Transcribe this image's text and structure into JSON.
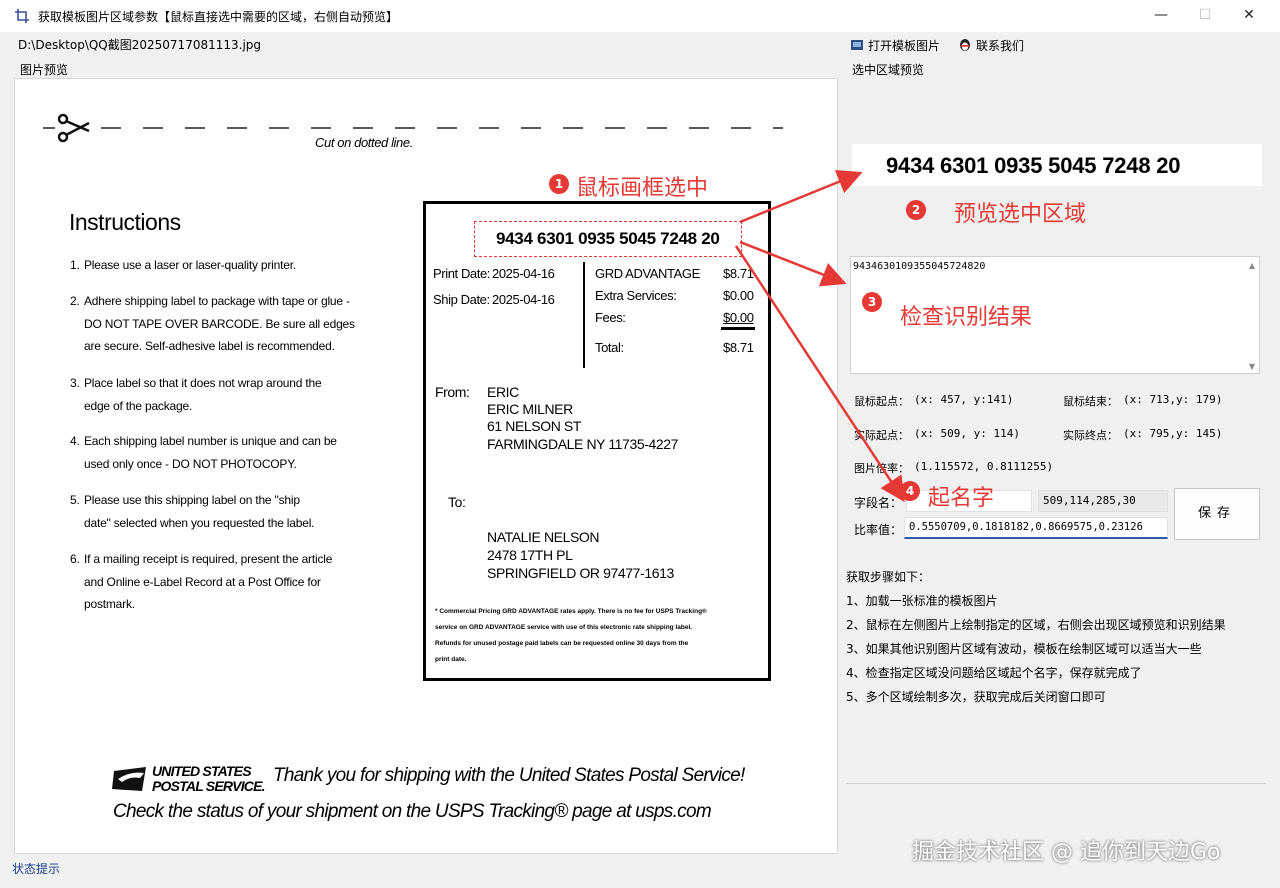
{
  "window": {
    "title": "获取模板图片区域参数【鼠标直接选中需要的区域，右侧自动预览】",
    "minimize": "—",
    "maximize": "☐",
    "close": "✕"
  },
  "path": "D:\\Desktop\\QQ截图20250717081113.jpg",
  "toolbar": {
    "open_label": "打开模板图片",
    "contact_label": "联系我们"
  },
  "left": {
    "group_label": "图片预览",
    "receipt": {
      "cut_text": "Cut on dotted line.",
      "instructions_title": "Instructions",
      "instructions": [
        {
          "num": "1.",
          "text": "Please use a laser or laser-quality printer."
        },
        {
          "num": "2.",
          "text": "Adhere shipping label to package with tape or glue - DO NOT TAPE OVER BARCODE. Be sure all edges are secure. Self-adhesive label is recommended."
        },
        {
          "num": "3.",
          "text": "Place label so that it does not wrap around the edge of the package."
        },
        {
          "num": "4.",
          "text": "Each shipping label number is unique and can be used only once - DO NOT PHOTOCOPY."
        },
        {
          "num": "5.",
          "text": "Please use this shipping label on the \"ship date\" selected when you requested the label."
        },
        {
          "num": "6.",
          "text": "If a mailing receipt is required, present the article and Online e-Label Record at a Post Office for postmark."
        }
      ],
      "tracking": "9434 6301 0935 5045 7248 20",
      "print_date_label": "Print Date:",
      "print_date": "2025-04-16",
      "ship_date_label": "Ship Date:",
      "ship_date": "2025-04-16",
      "service": "GRD ADVANTAGE",
      "service_price": "$8.71",
      "extra_label": "Extra Services:",
      "extra_price": "$0.00",
      "fees_label": "Fees:",
      "fees_price": "$0.00",
      "total_label": "Total:",
      "total_price": "$8.71",
      "from_label": "From:",
      "from_lines": [
        "ERIC",
        "ERIC MILNER",
        "61 NELSON ST",
        "FARMINGDALE NY 11735-4227"
      ],
      "to_label": "To:",
      "to_lines": [
        "NATALIE NELSON",
        "2478 17TH PL",
        "SPRINGFIELD OR 97477-1613"
      ],
      "fine_print": [
        "* Commercial Pricing GRD ADVANTAGE rates apply. There is no fee for USPS Tracking®",
        "service on GRD ADVANTAGE service with use of this electronic rate shipping label.",
        "Refunds for unused postage paid labels can be requested online 30 days from the",
        "print date."
      ],
      "usps_logo_line1": "UNITED STATES",
      "usps_logo_line2": "POSTAL SERVICE.",
      "thanks": "Thank you for shipping with the United States Postal Service!",
      "check_status": "Check the status of your shipment on the USPS Tracking® page at usps.com"
    }
  },
  "right": {
    "group_label": "选中区域预览",
    "crop_text": "9434 6301 0935 5045 7248 20",
    "result_text": "9434630109355045724820",
    "mouse_start_label": "鼠标起点：",
    "mouse_start": "(x: 457, y:141)",
    "mouse_end_label": "鼠标结束：",
    "mouse_end": "(x: 713,y: 179)",
    "real_start_label": "实际起点：",
    "real_start": "(x: 509, y: 114)",
    "real_end_label": "实际终点：",
    "real_end": "(x: 795,y: 145)",
    "ratio_label": "图片倍率：",
    "ratio": "(1.115572, 0.8111255)",
    "field_name_label": "字段名：",
    "field_name_value": "",
    "field_coords": "509,114,285,30",
    "rate_label": "比率值：",
    "rate_value": "0.5550709,0.1818182,0.8669575,0.23126",
    "save_label": "保存"
  },
  "steps": {
    "title": "获取步骤如下：",
    "items": [
      "1、加载一张标准的模板图片",
      "2、鼠标在左侧图片上绘制指定的区域，右侧会出现区域预览和识别结果",
      "3、如果其他识别图片区域有波动，模板在绘制区域可以适当大一些",
      "4、检查指定区域没问题给区域起个名字，保存就完成了",
      "5、多个区域绘制多次，获取完成后关闭窗口即可"
    ]
  },
  "annotations": [
    {
      "num": "1",
      "text": "鼠标画框选中"
    },
    {
      "num": "2",
      "text": "预览选中区域"
    },
    {
      "num": "3",
      "text": "检查识别结果"
    },
    {
      "num": "4",
      "text": "起名字"
    }
  ],
  "status": "状态提示",
  "watermark": "掘金技术社区 @ 追你到天边Go",
  "colors": {
    "annotation": "#e53935",
    "status_text": "#1a3e8c",
    "window_bg": "#f0f0f0"
  }
}
